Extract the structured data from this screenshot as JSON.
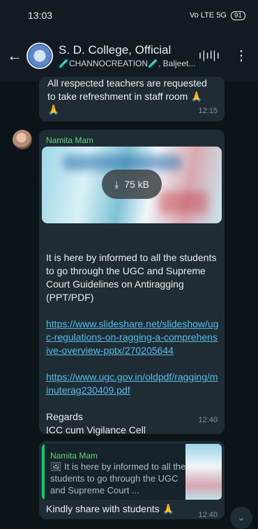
{
  "status": {
    "time": "13:03",
    "network": "Vo LTE 5G",
    "battery": "91"
  },
  "header": {
    "title": "S. D. College, Official",
    "subtitle": "🧪CHANNOCREATION🧪, Baljeet...",
    "back_icon": "arrow-left-icon",
    "call_icon": "voice-wave-icon",
    "menu_icon": "more-vertical-icon"
  },
  "messages": [
    {
      "text": "All respected teachers are requested to take refreshment in staff room 🙏🙏",
      "time": "12:15"
    },
    {
      "sender": "Namita Mam",
      "media_size": "75 kB",
      "intro": "It is here by informed to all the students to go through the UGC and Supreme Court Guidelines on Antiragging (PPT/PDF)",
      "links": [
        "https://www.slideshare.net/slideshow/ugc-regulations-on-ragging-a-comprehensive-overview-pptx/270205644",
        "https://www.ugc.gov.in/oldpdf/ragging/minuterag230409.pdf"
      ],
      "closing_1": "Regards",
      "closing_2": "ICC cum Vigilance Cell",
      "time": "12:40"
    },
    {
      "quote_sender": "Namita Mam",
      "quote_text": "It is here by informed to all the students to go through the UGC and Supreme Court ...",
      "text": "Kindly share with students 🙏",
      "time": "12:40"
    }
  ],
  "colors": {
    "sender_name": "#5fd67a",
    "link": "#53bdeb",
    "bubble": "#1f2c34",
    "background": "#0b1418"
  }
}
